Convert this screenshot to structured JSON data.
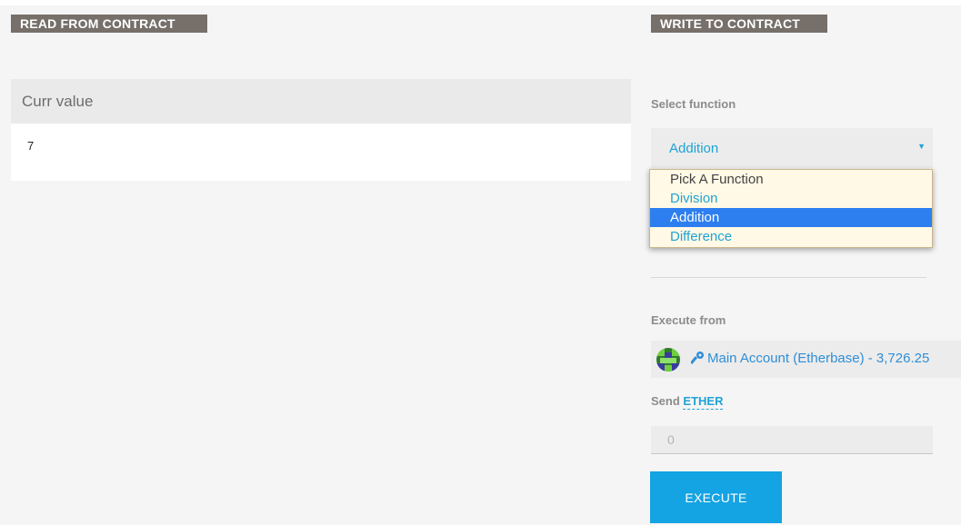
{
  "read_section": {
    "label": "READ FROM CONTRACT",
    "field_title": "Curr value",
    "field_value": "7"
  },
  "write_section": {
    "label": "WRITE TO CONTRACT",
    "select_function_label": "Select function",
    "selected_function": "Addition",
    "function_options": [
      "Pick A Function",
      "Division",
      "Addition",
      "Difference"
    ],
    "execute_from_label": "Execute from",
    "account": {
      "name": "Main Account (Etherbase) - 3,726.25",
      "icon": "identicon",
      "key_icon": "key-icon"
    },
    "send_label": "Send",
    "send_unit": "ETHER",
    "amount_placeholder": "0",
    "execute_button": "EXECUTE"
  },
  "colors": {
    "accent": "#1fa3d5",
    "button": "#14a3e3",
    "label_bg": "#766f6a",
    "highlight": "#2d7ff0"
  }
}
